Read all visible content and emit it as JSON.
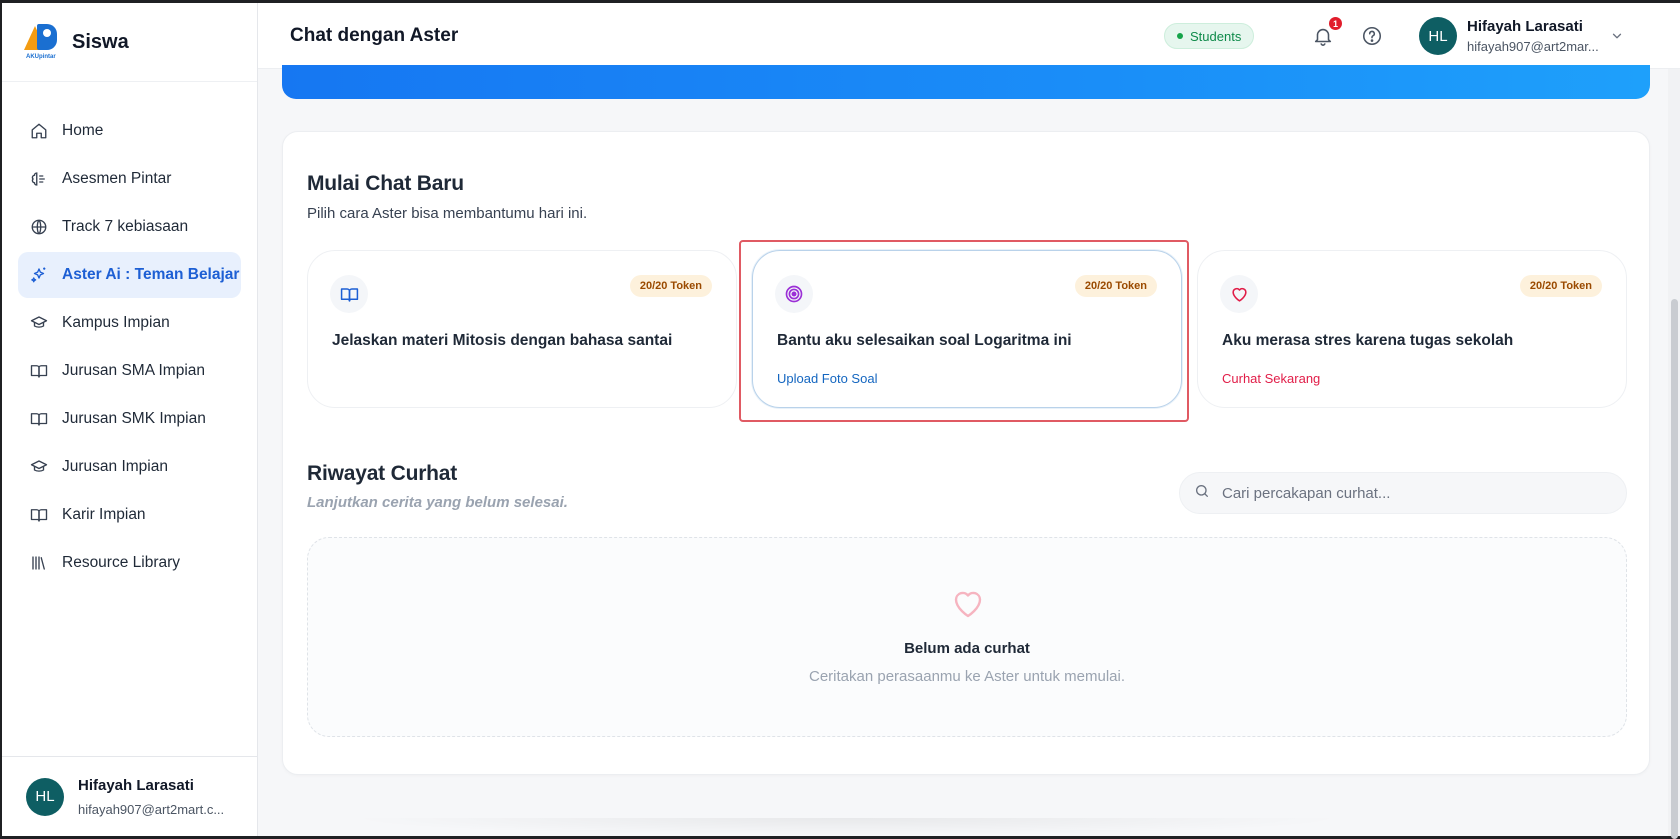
{
  "app": {
    "brand": "Siswa",
    "logo_text": "AKUpintar"
  },
  "sidebar": {
    "items": [
      {
        "label": "Home",
        "icon": "home-icon"
      },
      {
        "label": "Asesmen Pintar",
        "icon": "brain-icon"
      },
      {
        "label": "Track 7 kebiasaan",
        "icon": "globe-icon"
      },
      {
        "label": "Aster Ai : Teman Belajar",
        "icon": "sparkles-icon",
        "active": true
      },
      {
        "label": "Kampus Impian",
        "icon": "graduation-cap-icon"
      },
      {
        "label": "Jurusan SMA Impian",
        "icon": "book-open-icon"
      },
      {
        "label": "Jurusan SMK Impian",
        "icon": "book-open-icon"
      },
      {
        "label": "Jurusan Impian",
        "icon": "graduation-cap-icon"
      },
      {
        "label": "Karir Impian",
        "icon": "book-open-icon"
      },
      {
        "label": "Resource Library",
        "icon": "library-icon"
      }
    ],
    "user": {
      "initials": "HL",
      "name": "Hifayah Larasati",
      "email": "hifayah907@art2mart.c..."
    }
  },
  "header": {
    "title": "Chat dengan Aster",
    "role_badge": "Students",
    "notification_count": "1",
    "user": {
      "initials": "HL",
      "name": "Hifayah Larasati",
      "email": "hifayah907@art2mar..."
    }
  },
  "new_chat": {
    "title": "Mulai Chat Baru",
    "subtitle": "Pilih cara Aster bisa membantumu hari ini.",
    "cards": [
      {
        "icon": "book-open-icon",
        "token": "20/20 Token",
        "text": "Jelaskan materi Mitosis dengan bahasa santai",
        "link": ""
      },
      {
        "icon": "target-icon",
        "token": "20/20 Token",
        "text": "Bantu aku selesaikan soal Logaritma ini",
        "link": "Upload Foto Soal"
      },
      {
        "icon": "heart-icon",
        "token": "20/20 Token",
        "text": "Aku merasa stres karena tugas sekolah",
        "link": "Curhat Sekarang"
      }
    ]
  },
  "history": {
    "title": "Riwayat Curhat",
    "subtitle": "Lanjutkan cerita yang belum selesai.",
    "search_placeholder": "Cari percakapan curhat...",
    "empty_title": "Belum ada curhat",
    "empty_subtitle": "Ceritakan perasaanmu ke Aster untuk memulai."
  },
  "colors": {
    "accent": "#1d5fd4",
    "link_blue": "#1466c0",
    "link_red": "#e11d48",
    "token_bg": "#fdf1dc",
    "highlight": "#e05a63"
  }
}
